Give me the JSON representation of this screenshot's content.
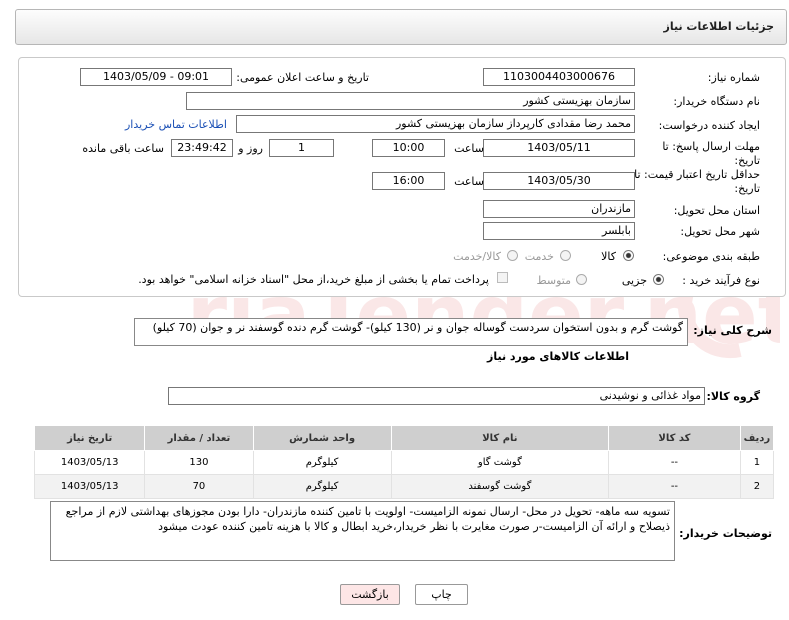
{
  "header": {
    "title": "جزئیات اطلاعات نیاز"
  },
  "form": {
    "need_number_label": "شماره نیاز:",
    "need_number": "1103004403000676",
    "announce_label": "تاریخ و ساعت اعلان عمومی:",
    "announce_value": "1403/05/09 - 09:01",
    "buyer_org_label": "نام دستگاه خریدار:",
    "buyer_org": "سازمان بهزیستی کشور",
    "creator_label": "ایجاد کننده درخواست:",
    "creator": "محمد رضا  مقدادی کارپرداز سازمان بهزیستی کشور",
    "contact_link": "اطلاعات تماس خریدار",
    "deadline_label_1": "مهلت ارسال پاسخ: تا",
    "deadline_label_2": "تاریخ:",
    "deadline_date": "1403/05/11",
    "time_label": "ساعت",
    "deadline_time": "10:00",
    "days_value": "1",
    "days_label": "روز و",
    "remaining_time": "23:49:42",
    "remaining_label": "ساعت باقی مانده",
    "validity_label_1": "حداقل تاریخ اعتبار قیمت: تا",
    "validity_label_2": "تاریخ:",
    "validity_date": "1403/05/30",
    "validity_time": "16:00",
    "province_label": "استان محل تحویل:",
    "province": "مازندران",
    "city_label": "شهر محل تحویل:",
    "city": "بابلسر",
    "category_label": "طبقه بندی موضوعی:",
    "category_options": [
      "کالا",
      "خدمت",
      "کالا/خدمت"
    ],
    "category_selected": "کالا",
    "process_label": "نوع فرآیند خرید :",
    "process_options": [
      "جزیی",
      "متوسط"
    ],
    "process_selected": "جزیی",
    "payment_note": "پرداخت تمام یا بخشی از مبلغ خرید،از محل \"اسناد خزانه اسلامی\" خواهد بود."
  },
  "summary": {
    "label": "شرح کلی نیاز:",
    "text": "گوشت گرم و بدون استخوان سردست گوساله جوان و نر (130 کیلو)- گوشت گرم دنده گوسفند نر و جوان (70 کیلو)"
  },
  "goods": {
    "section_title": "اطلاعات کالاهای مورد نیاز",
    "group_label": "گروه کالا:",
    "group_value": "مواد غذائی و نوشیدنی",
    "columns": [
      "ردیف",
      "کد کالا",
      "نام کالا",
      "واحد شمارش",
      "تعداد / مقدار",
      "تاریخ نیاز"
    ],
    "rows": [
      {
        "idx": "1",
        "code": "--",
        "name": "گوشت گاو",
        "unit": "کیلوگرم",
        "qty": "130",
        "date": "1403/05/13"
      },
      {
        "idx": "2",
        "code": "--",
        "name": "گوشت گوسفند",
        "unit": "کیلوگرم",
        "qty": "70",
        "date": "1403/05/13"
      }
    ]
  },
  "buyer_notes": {
    "label": "توضیحات خریدار:",
    "text": "تسویه سه ماهه- تحویل در محل- ارسال نمونه الزامیست- اولویت با تامین کننده مازندران- دارا بودن مجوزهای بهداشتی لازم از مراجع ذیصلاح  و ارائه آن الزامیست-ر صورت مغایرت با نظر خریدار،خرید ابطال و کالا با هزینه تامین کننده عودت میشود"
  },
  "buttons": {
    "print": "چاپ",
    "back": "بازگشت"
  },
  "watermark": {
    "text": "AriaTender.net"
  },
  "colors": {
    "link": "#1a4fb5",
    "back_button_bg": "#fde6e6",
    "print_button_bg": "#fff"
  }
}
